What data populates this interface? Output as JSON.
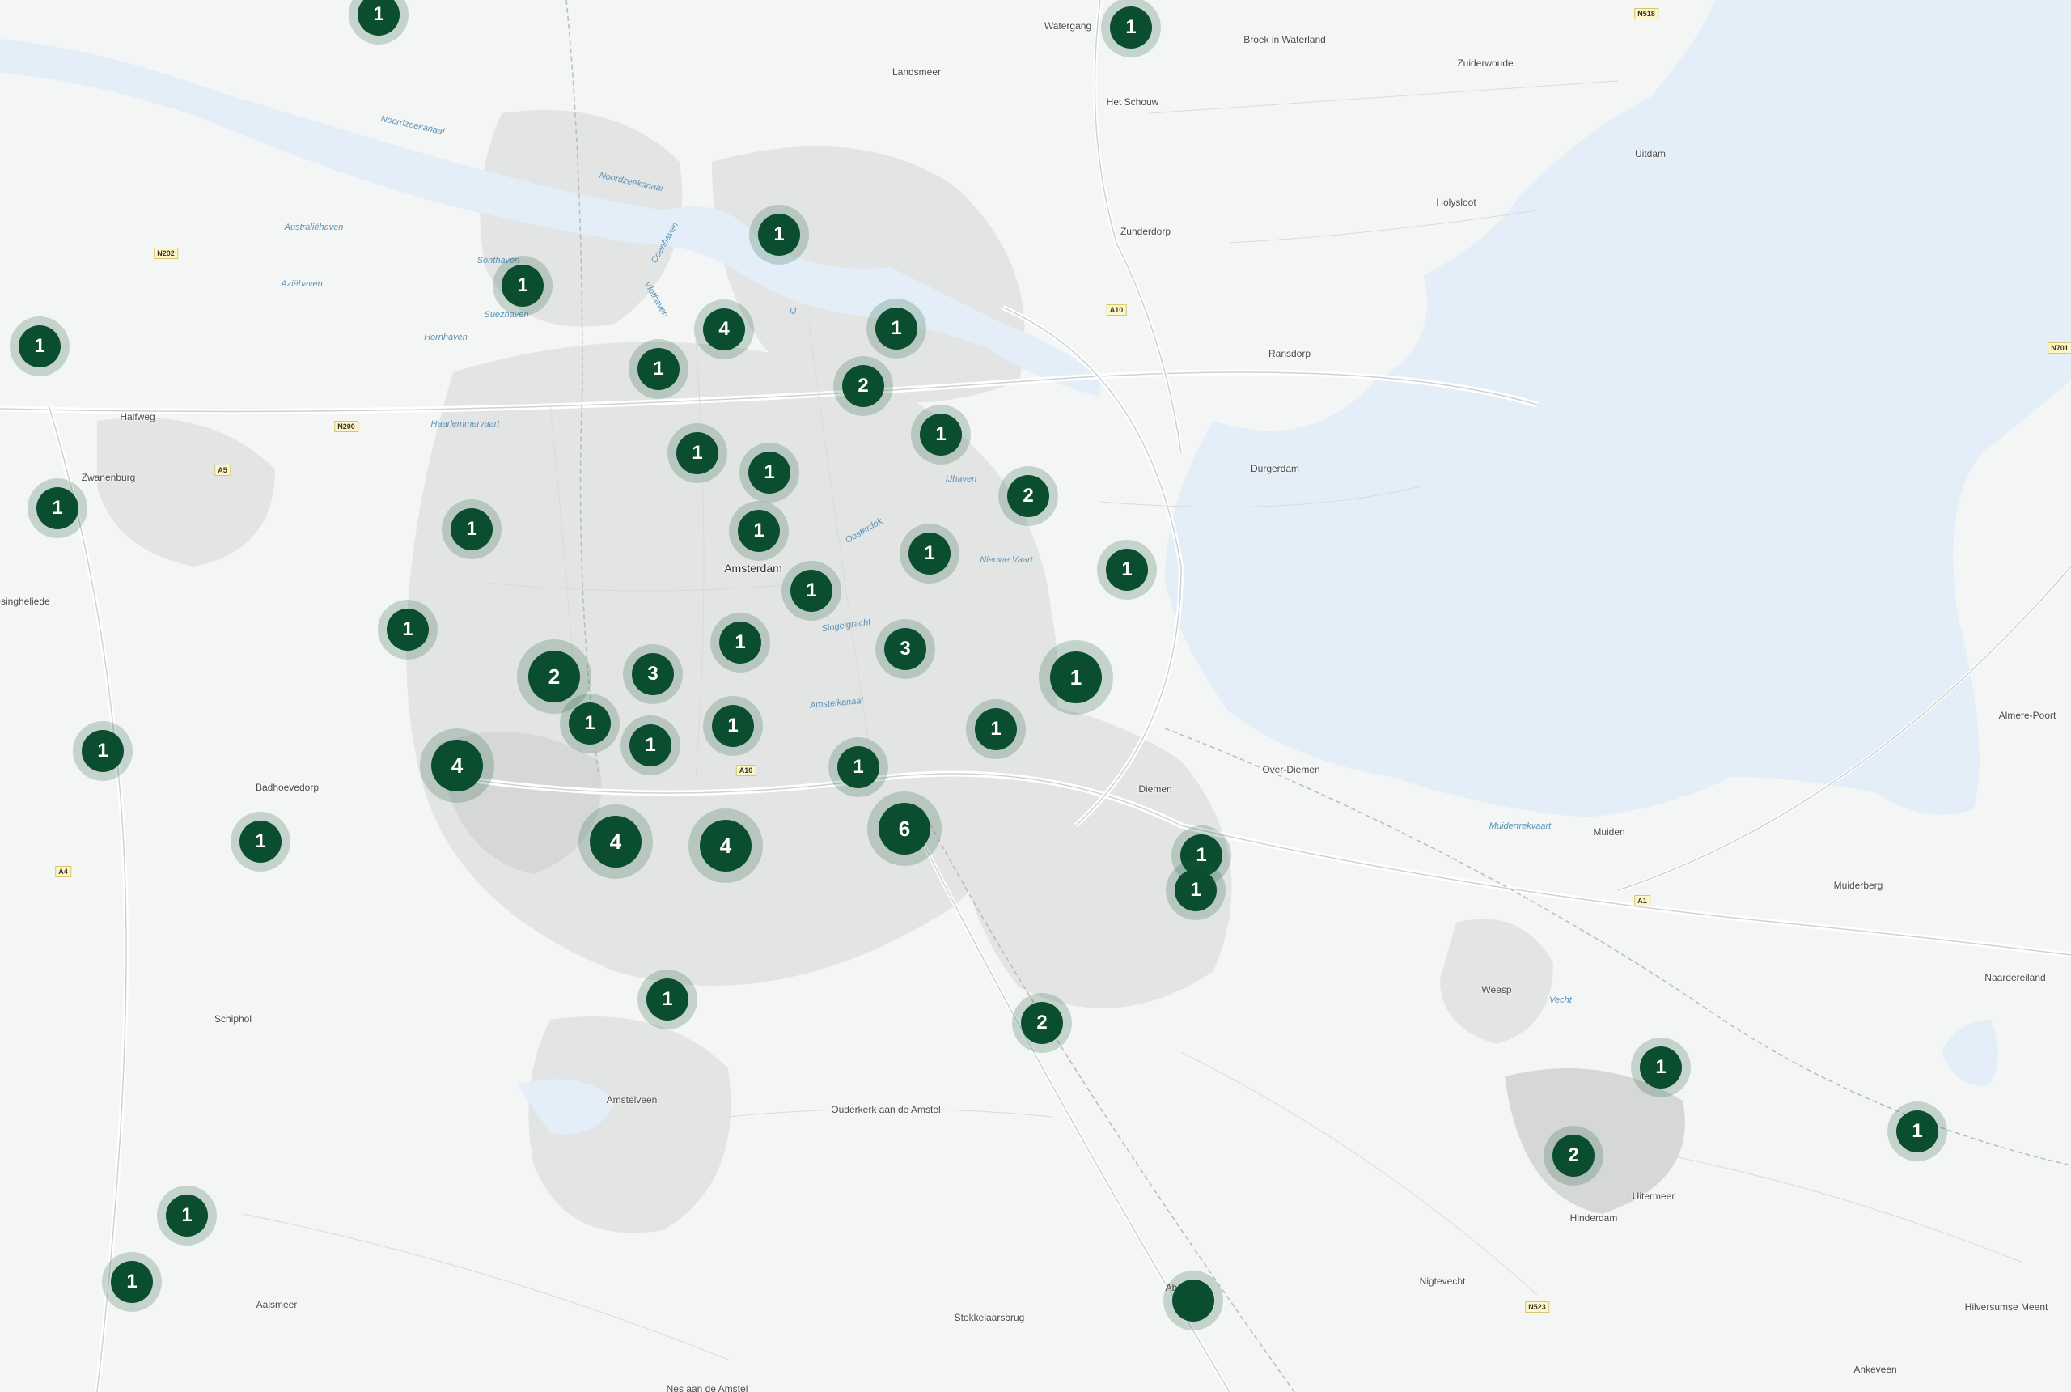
{
  "places": [
    {
      "id": "watergang",
      "text": "Watergang"
    },
    {
      "id": "broek-in-waterland",
      "text": "Broek in Waterland"
    },
    {
      "id": "zuiderwoude",
      "text": "Zuiderwoude"
    },
    {
      "id": "landsmeer",
      "text": "Landsmeer"
    },
    {
      "id": "het-schouw",
      "text": "Het Schouw"
    },
    {
      "id": "uitdam",
      "text": "Uitdam"
    },
    {
      "id": "holysloot",
      "text": "Holysloot"
    },
    {
      "id": "zunderdorp",
      "text": "Zunderdorp"
    },
    {
      "id": "ransdorp",
      "text": "Ransdorp"
    },
    {
      "id": "durgerdam",
      "text": "Durgerdam"
    },
    {
      "id": "halfweg",
      "text": "Halfweg"
    },
    {
      "id": "zwanenburg",
      "text": "Zwanenburg"
    },
    {
      "id": "amsterdam",
      "text": "Amsterdam"
    },
    {
      "id": "lijnden",
      "text": "esingheliede"
    },
    {
      "id": "badhoevedorp",
      "text": "Badhoevedorp"
    },
    {
      "id": "diemen",
      "text": "Diemen"
    },
    {
      "id": "over-diemen",
      "text": "Over-Diemen"
    },
    {
      "id": "muiden",
      "text": "Muiden"
    },
    {
      "id": "almere-poort",
      "text": "Almere-Poort"
    },
    {
      "id": "muiderberg",
      "text": "Muiderberg"
    },
    {
      "id": "naardereiland",
      "text": "Naardereiland"
    },
    {
      "id": "schiphol",
      "text": "Schiphol"
    },
    {
      "id": "weesp",
      "text": "Weesp"
    },
    {
      "id": "amstelveen",
      "text": "Amstelveen"
    },
    {
      "id": "ouderkerk",
      "text": "Ouderkerk aan de Amstel"
    },
    {
      "id": "uitermeer",
      "text": "Uitermeer"
    },
    {
      "id": "hinderdam",
      "text": "Hinderdam"
    },
    {
      "id": "nigtevecht",
      "text": "Nigtevecht"
    },
    {
      "id": "aalsmeer",
      "text": "Aalsmeer"
    },
    {
      "id": "stokkelaarsbrug",
      "text": "Stokkelaarsbrug"
    },
    {
      "id": "hilversumse-meent",
      "text": "Hilversumse Meent"
    },
    {
      "id": "ankeveen",
      "text": "Ankeveen"
    },
    {
      "id": "nes-aan-de-amstel",
      "text": "Nes aan de Amstel"
    },
    {
      "id": "abcoude",
      "text": "Ab"
    }
  ],
  "water_labels": [
    {
      "id": "noordzeekanaal-1",
      "text": "Noordzeekanaal"
    },
    {
      "id": "noordzeekanaal-2",
      "text": "Noordzeekanaal"
    },
    {
      "id": "australiehaven",
      "text": "Australiëhaven"
    },
    {
      "id": "aziehaven",
      "text": "Aziëhaven"
    },
    {
      "id": "hornhaven",
      "text": "Hornhaven"
    },
    {
      "id": "suezhaven",
      "text": "Suezhaven"
    },
    {
      "id": "sonthaven",
      "text": "Sonthaven"
    },
    {
      "id": "vlothaven",
      "text": "Vlothaven"
    },
    {
      "id": "coenhaven",
      "text": "Coenhaven"
    },
    {
      "id": "ij",
      "text": "IJ"
    },
    {
      "id": "nieuwe-vaart",
      "text": "Nieuwe Vaart"
    },
    {
      "id": "singelgracht",
      "text": "Singelgracht"
    },
    {
      "id": "amstelkanaal",
      "text": "Amstelkanaal"
    },
    {
      "id": "muidertrekvaart",
      "text": "Muidertrekvaart"
    },
    {
      "id": "vecht",
      "text": "Vecht"
    },
    {
      "id": "ijhaven",
      "text": "IJhaven"
    },
    {
      "id": "oosterdok",
      "text": "Oosterdok"
    },
    {
      "id": "haarlemmervaart",
      "text": "Haarlemmervaart"
    }
  ],
  "road_shields": [
    {
      "id": "n518",
      "text": "N518"
    },
    {
      "id": "n202",
      "text": "N202"
    },
    {
      "id": "n200",
      "text": "N200"
    },
    {
      "id": "a10-north",
      "text": "A10"
    },
    {
      "id": "a10-south",
      "text": "A10"
    },
    {
      "id": "a5",
      "text": "A5"
    },
    {
      "id": "a4",
      "text": "A4"
    },
    {
      "id": "a1",
      "text": "A1"
    },
    {
      "id": "n523",
      "text": "N523"
    },
    {
      "id": "n701",
      "text": "N701"
    }
  ],
  "clusters": [
    {
      "id": "c01",
      "count": "1"
    },
    {
      "id": "c02",
      "count": "1"
    },
    {
      "id": "c03",
      "count": "1"
    },
    {
      "id": "c04",
      "count": "1"
    },
    {
      "id": "c05",
      "count": "4"
    },
    {
      "id": "c06",
      "count": "1"
    },
    {
      "id": "c07",
      "count": "1"
    },
    {
      "id": "c08",
      "count": "2"
    },
    {
      "id": "c09",
      "count": "1"
    },
    {
      "id": "c10",
      "count": "1"
    },
    {
      "id": "c11",
      "count": "1"
    },
    {
      "id": "c12",
      "count": "1"
    },
    {
      "id": "c13",
      "count": "2"
    },
    {
      "id": "c14",
      "count": "1"
    },
    {
      "id": "c15",
      "count": "1"
    },
    {
      "id": "c16",
      "count": "1"
    },
    {
      "id": "c17",
      "count": "1"
    },
    {
      "id": "c18",
      "count": "1"
    },
    {
      "id": "c19",
      "count": "1"
    },
    {
      "id": "c20",
      "count": "1"
    },
    {
      "id": "c21",
      "count": "1"
    },
    {
      "id": "c22",
      "count": "3"
    },
    {
      "id": "c23",
      "count": "2"
    },
    {
      "id": "c24",
      "count": "3"
    },
    {
      "id": "c25",
      "count": "1"
    },
    {
      "id": "c26",
      "count": "1"
    },
    {
      "id": "c27",
      "count": "1"
    },
    {
      "id": "c28",
      "count": "1"
    },
    {
      "id": "c29",
      "count": "1"
    },
    {
      "id": "c30",
      "count": "1"
    },
    {
      "id": "c31",
      "count": "4"
    },
    {
      "id": "c32",
      "count": "1"
    },
    {
      "id": "c33",
      "count": "4"
    },
    {
      "id": "c34",
      "count": "4"
    },
    {
      "id": "c35",
      "count": "6"
    },
    {
      "id": "c36",
      "count": "1"
    },
    {
      "id": "c37",
      "count": "1"
    },
    {
      "id": "c38",
      "count": "1"
    },
    {
      "id": "c39",
      "count": "2"
    },
    {
      "id": "c40",
      "count": "1"
    },
    {
      "id": "c41",
      "count": "1"
    },
    {
      "id": "c42",
      "count": "1"
    },
    {
      "id": "c43",
      "count": "2"
    },
    {
      "id": "c44",
      "count": "1"
    },
    {
      "id": "c45",
      "count": "1"
    }
  ]
}
